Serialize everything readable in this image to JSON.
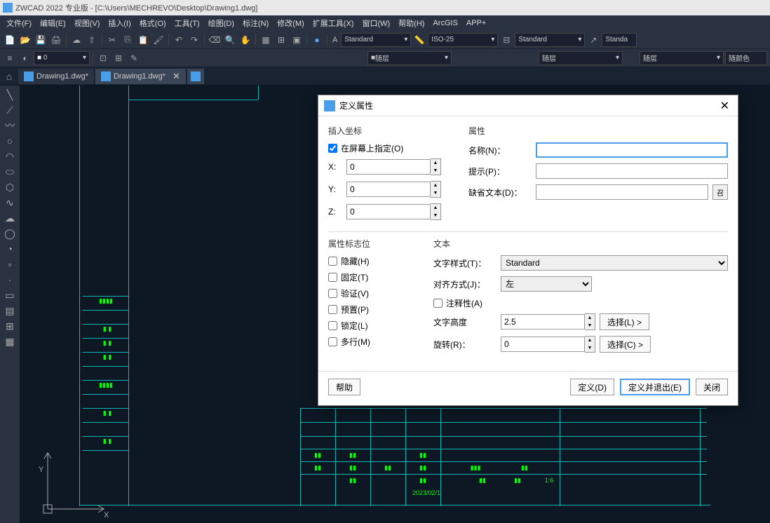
{
  "titlebar": {
    "text": "ZWCAD 2022 专业版 - [C:\\Users\\MECHREVO\\Desktop\\Drawing1.dwg]"
  },
  "menu": [
    "文件(F)",
    "编辑(E)",
    "视图(V)",
    "插入(I)",
    "格式(O)",
    "工具(T)",
    "绘图(D)",
    "标注(N)",
    "修改(M)",
    "扩展工具(X)",
    "窗口(W)",
    "帮助(H)",
    "ArcGIS",
    "APP+"
  ],
  "toolbar_combos": {
    "text_style": "Standard",
    "dim_style": "ISO-25",
    "table_style": "Standard",
    "other": "Standa"
  },
  "toolbar2_combos": {
    "layer": "随层",
    "c1": "随层",
    "c2": "随层",
    "c3": "随颜色"
  },
  "tabs": [
    {
      "label": "Drawing1.dwg*",
      "active": false
    },
    {
      "label": "Drawing1.dwg*",
      "active": true
    }
  ],
  "dialog": {
    "title": "定义属性",
    "sections": {
      "insert": "插入坐标",
      "insert_check": "在屏幕上指定(O)",
      "x_label": "X:",
      "x": "0",
      "y_label": "Y:",
      "y": "0",
      "z_label": "Z:",
      "z": "0",
      "attr": "属性",
      "name_label": "名称(N)：",
      "name": "",
      "prompt_label": "提示(P)：",
      "prompt": "",
      "default_label": "缺省文本(D)：",
      "default": "",
      "flags": "属性标志位",
      "flag_hidden": "隐藏(H)",
      "flag_fixed": "固定(T)",
      "flag_verify": "验证(V)",
      "flag_preset": "预置(P)",
      "flag_lock": "锁定(L)",
      "flag_multi": "多行(M)",
      "text": "文本",
      "style_label": "文字样式(T)：",
      "style": "Standard",
      "align_label": "对齐方式(J)：",
      "align": "左",
      "annotative": "注释性(A)",
      "height_label": "文字高度",
      "height": "2.5",
      "height_btn": "选择(L) >",
      "rotate_label": "旋转(R)：",
      "rotate": "0",
      "rotate_btn": "选择(C) >"
    },
    "buttons": {
      "help": "帮助",
      "define": "定义(D)",
      "define_exit": "定义并退出(E)",
      "close": "关闭"
    }
  },
  "axis": {
    "y": "Y",
    "x": "X"
  }
}
